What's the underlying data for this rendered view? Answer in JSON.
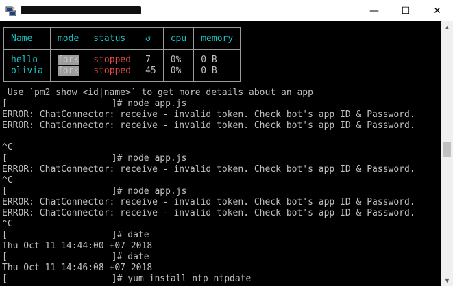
{
  "window": {
    "controls": [
      "—",
      "☐",
      "✕"
    ]
  },
  "pm2": {
    "headers": [
      "Name",
      "mode",
      "status",
      "↺",
      "cpu",
      "memory"
    ],
    "rows": [
      {
        "name": "hello",
        "mode": "fork",
        "status": "stopped",
        "restarts": "7",
        "cpu": "0%",
        "memory": "0 B"
      },
      {
        "name": "olivia",
        "mode": "fork",
        "status": "stopped",
        "restarts": "45",
        "cpu": "0%",
        "memory": "0 B"
      }
    ]
  },
  "lines": [
    " Use `pm2 show <id|name>` to get more details about an app",
    "]# node app.js",
    "ERROR: ChatConnector: receive - invalid token. Check bot's app ID & Password.",
    "ERROR: ChatConnector: receive - invalid token. Check bot's app ID & Password.",
    "",
    "^C",
    "]# node app.js",
    "ERROR: ChatConnector: receive - invalid token. Check bot's app ID & Password.",
    "^C",
    "]# node app.js",
    "ERROR: ChatConnector: receive - invalid token. Check bot's app ID & Password.",
    "ERROR: ChatConnector: receive - invalid token. Check bot's app ID & Password.",
    "^C",
    "]# date",
    "Thu Oct 11 14:44:00 +07 2018",
    "]# date",
    "Thu Oct 11 14:46:08 +07 2018",
    "]# yum install ntp ntpdate"
  ],
  "prompt_open": "[",
  "icons": {
    "app": "putty-icon",
    "scroll_up": "▲",
    "scroll_down": "▼"
  }
}
